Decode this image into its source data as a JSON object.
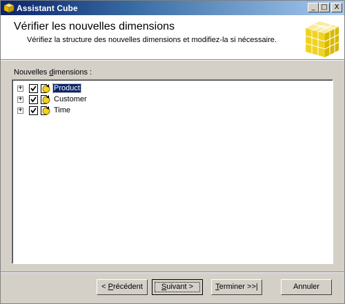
{
  "window": {
    "title": "Assistant Cube",
    "controls": {
      "minimize": "_",
      "maximize": "□",
      "close": "X"
    }
  },
  "header": {
    "title": "Vérifier les nouvelles dimensions",
    "subtitle": "Vérifiez la structure des nouvelles dimensions et modifiez-la si nécessaire."
  },
  "list": {
    "label_before": "Nouvelles ",
    "label_accel": "d",
    "label_after": "imensions :",
    "items": [
      {
        "label": "Product",
        "checked": true,
        "selected": true,
        "expander": "+"
      },
      {
        "label": "Customer",
        "checked": true,
        "selected": false,
        "expander": "+"
      },
      {
        "label": "Time",
        "checked": true,
        "selected": false,
        "expander": "+"
      }
    ]
  },
  "buttons": {
    "back_pre": "< ",
    "back_accel": "P",
    "back_post": "récédent",
    "next_accel": "S",
    "next_post": "uivant >",
    "finish_accel": "T",
    "finish_post": "erminer >>|",
    "cancel": "Annuler"
  },
  "colors": {
    "titlebar_start": "#0a246a",
    "selection": "#0a246a",
    "face": "#d4d0c8",
    "cube_yellow": "#f2d21c"
  }
}
